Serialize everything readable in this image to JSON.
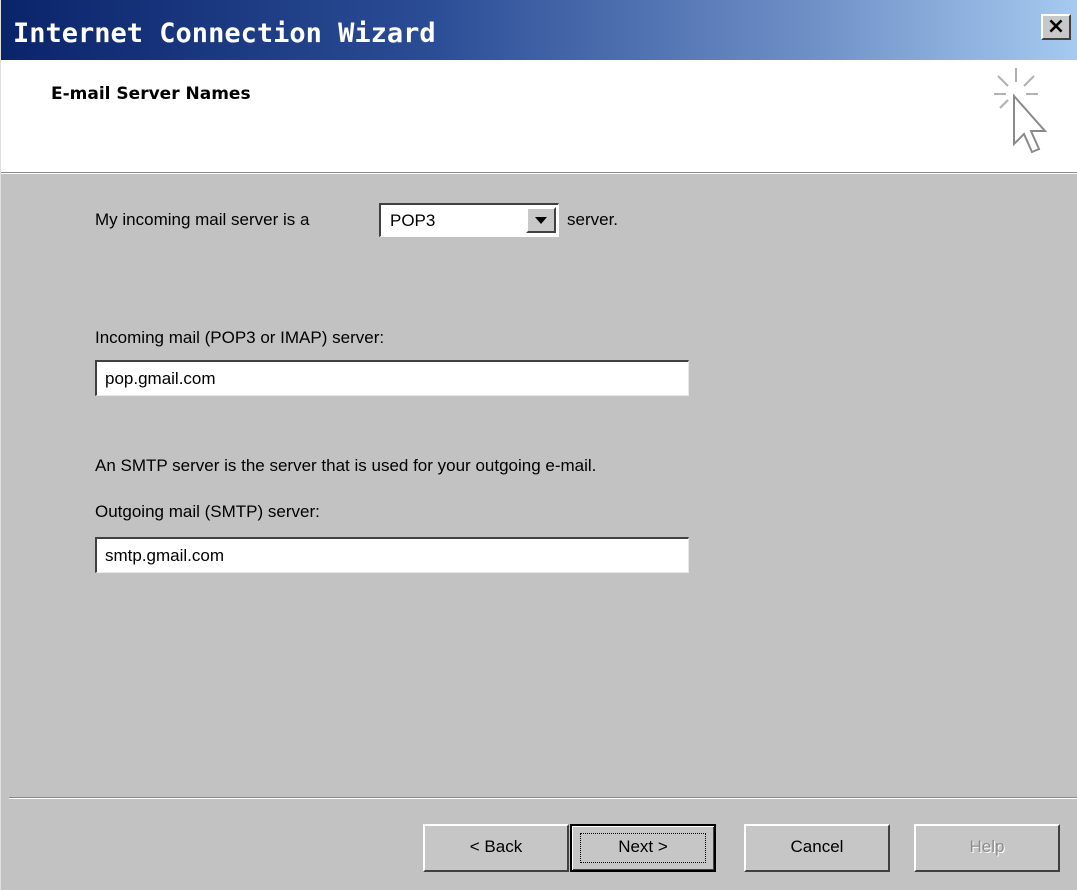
{
  "window": {
    "title": "Internet Connection Wizard",
    "close_glyph": "×"
  },
  "header": {
    "title": "E-mail Server Names",
    "icon": "wizard-cursor-sparkle-icon"
  },
  "form": {
    "server_type": {
      "label_prefix": "My incoming mail server is a",
      "selected": "POP3",
      "label_suffix": "server."
    },
    "incoming": {
      "label": "Incoming mail (POP3 or IMAP) server:",
      "value": "pop.gmail.com"
    },
    "smtp_note": "An SMTP server is the server that is used for your outgoing e-mail.",
    "outgoing": {
      "label": "Outgoing mail (SMTP) server:",
      "value": "smtp.gmail.com"
    }
  },
  "buttons": {
    "back": "< Back",
    "next": "Next >",
    "cancel": "Cancel",
    "help": "Help"
  },
  "colors": {
    "title_gradient_start": "#0a246a",
    "title_gradient_end": "#a6caf0",
    "dialog_face": "#c2c2c2"
  }
}
